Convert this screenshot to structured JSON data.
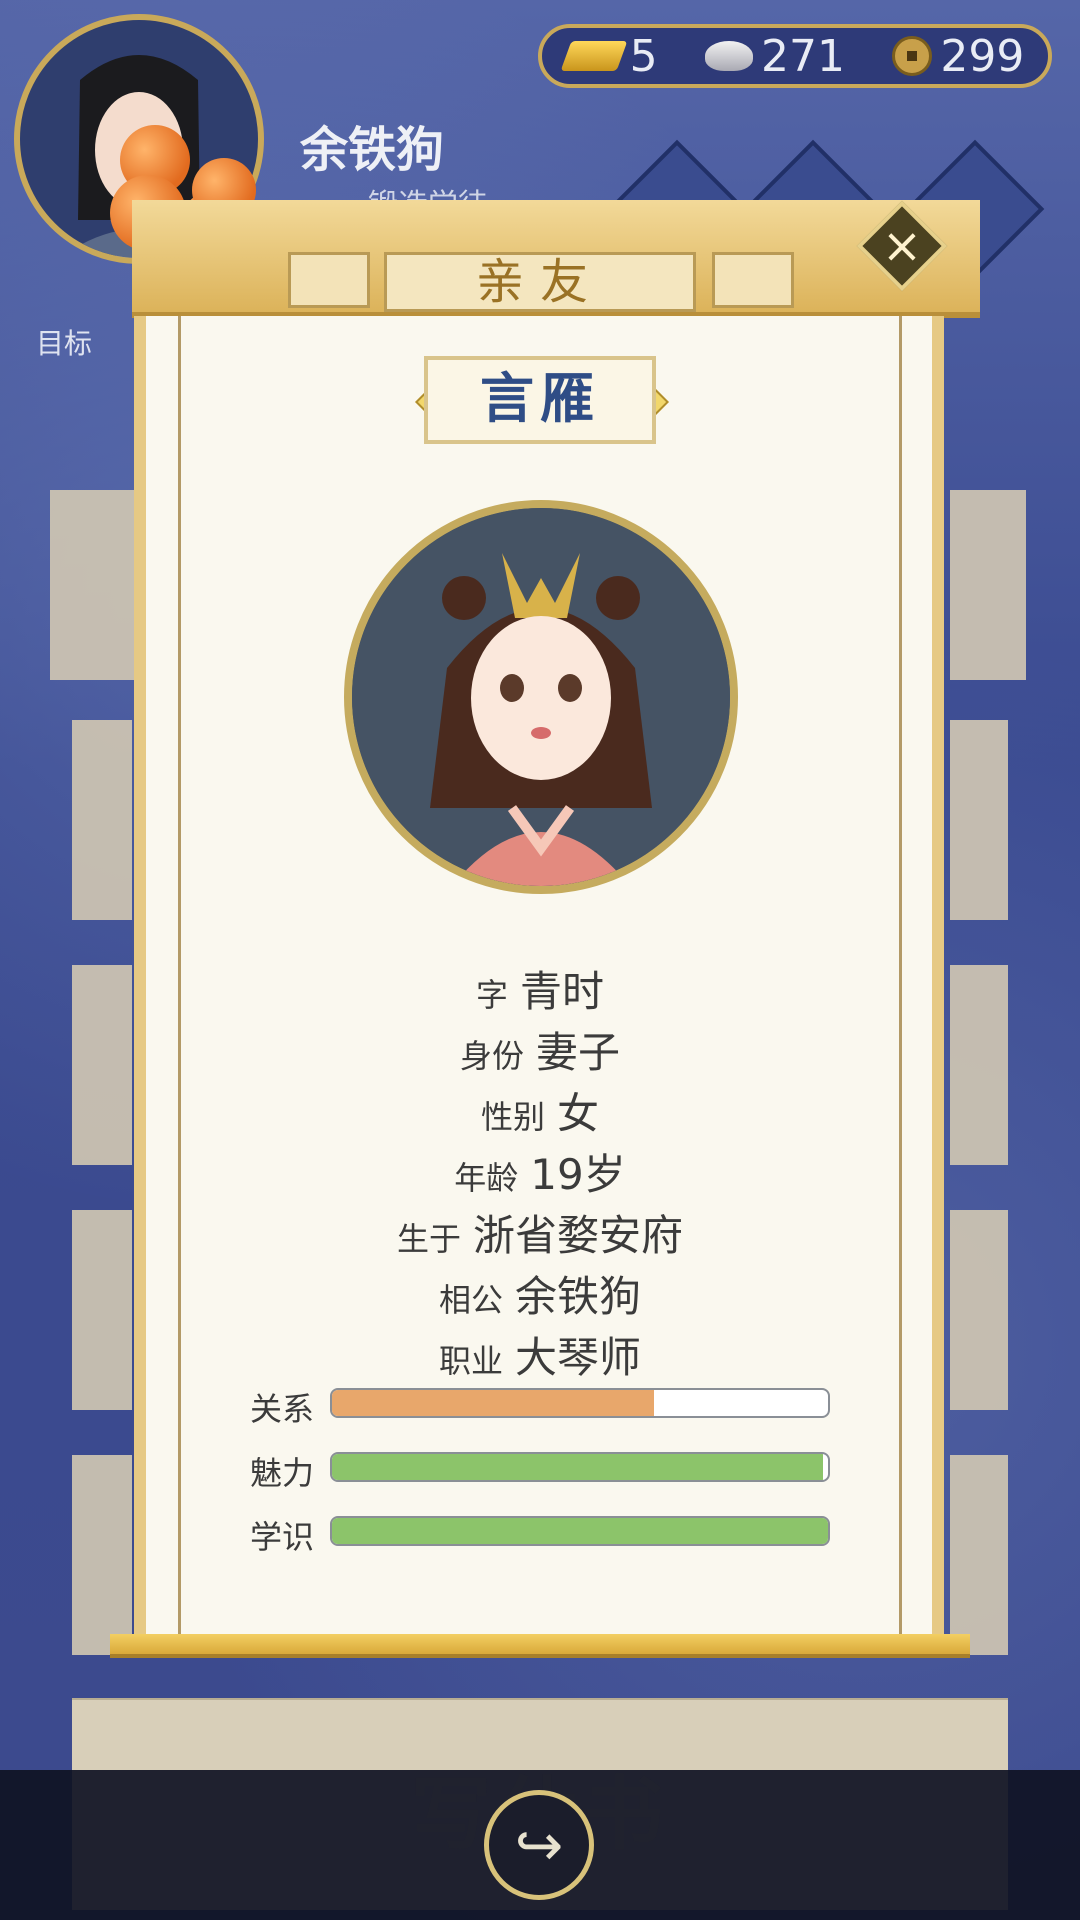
{
  "player": {
    "name": "余铁狗",
    "title": "锻造学徒"
  },
  "currency": {
    "gold": "5",
    "silver": "271",
    "coins": "299"
  },
  "hud": {
    "goal_label": "目标"
  },
  "panel": {
    "tab_title": "亲友",
    "close_symbol": "×",
    "character_name": "言雁",
    "info": [
      {
        "key": "字",
        "value": "青时"
      },
      {
        "key": "身份",
        "value": "妻子"
      },
      {
        "key": "性别",
        "value": "女"
      },
      {
        "key": "年龄",
        "value": "19岁"
      },
      {
        "key": "生于",
        "value": "浙省婺安府"
      },
      {
        "key": "相公",
        "value": "余铁狗"
      },
      {
        "key": "职业",
        "value": "大琴师"
      }
    ],
    "stats": [
      {
        "label": "关系",
        "fraction": 0.65,
        "color": "#e8a76b"
      },
      {
        "label": "魅力",
        "fraction": 0.99,
        "color": "#8cc46a"
      },
      {
        "label": "学识",
        "fraction": 1.0,
        "color": "#8cc46a"
      }
    ]
  },
  "bottom": {
    "write_title": "写休书",
    "share_icon": "share-icon"
  }
}
